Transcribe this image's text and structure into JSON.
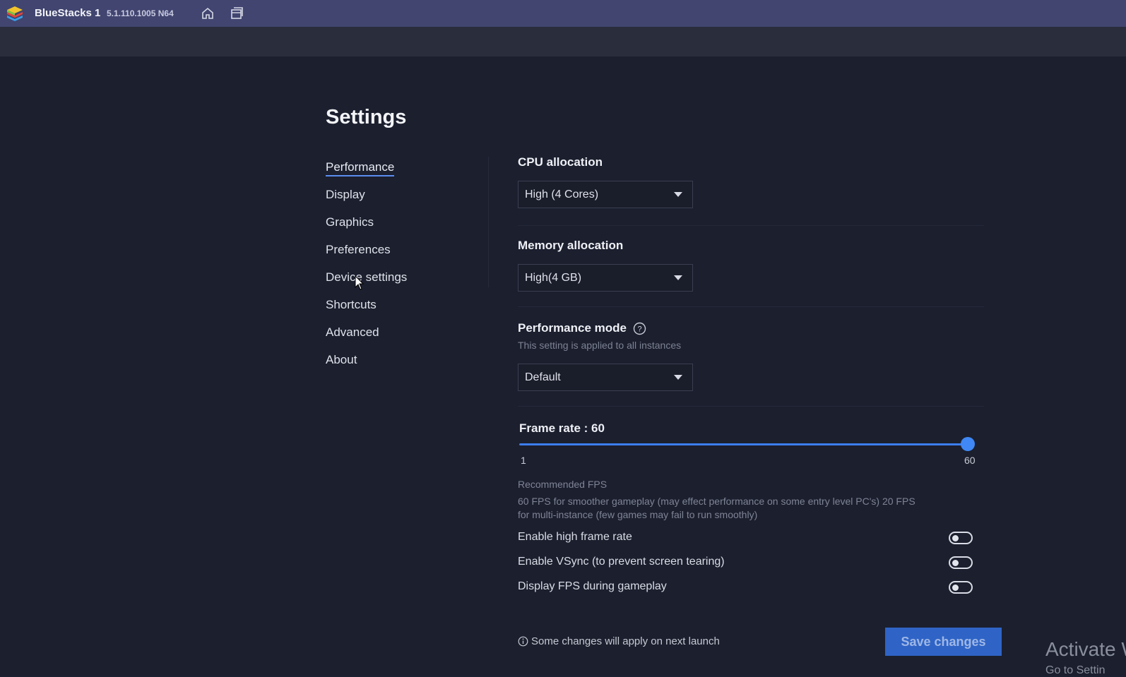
{
  "titlebar": {
    "app_name": "BlueStacks 1",
    "version": "5.1.110.1005 N64"
  },
  "settings": {
    "title": "Settings",
    "nav": [
      {
        "label": "Performance",
        "active": true
      },
      {
        "label": "Display"
      },
      {
        "label": "Graphics"
      },
      {
        "label": "Preferences"
      },
      {
        "label": "Device settings"
      },
      {
        "label": "Shortcuts"
      },
      {
        "label": "Advanced"
      },
      {
        "label": "About"
      }
    ]
  },
  "performance": {
    "cpu_label": "CPU allocation",
    "cpu_value": "High (4 Cores)",
    "memory_label": "Memory allocation",
    "memory_value": "High(4 GB)",
    "mode_label": "Performance mode",
    "mode_note": "This setting is applied to all instances",
    "mode_value": "Default",
    "frame_rate_label": "Frame rate : 60",
    "frame_rate": {
      "min": "1",
      "max": "60",
      "value": 60
    },
    "recommended_title": "Recommended FPS",
    "recommended_text_1": "60 FPS for smoother gameplay (may effect performance on some entry level PC's) 20 FPS",
    "recommended_text_2": "for multi-instance (few games may fail to run smoothly)",
    "toggles": [
      {
        "label": "Enable high frame rate",
        "on": false
      },
      {
        "label": "Enable VSync (to prevent screen tearing)",
        "on": false
      },
      {
        "label": "Display FPS during gameplay",
        "on": false
      }
    ],
    "note": "Some changes will apply on next launch",
    "save_label": "Save changes"
  },
  "watermark": {
    "line1": "Activate W",
    "line2": "Go to Settin"
  },
  "colors": {
    "titlebar": "#414570",
    "background": "#1b1f2e",
    "accent": "#3f88f5",
    "save_button": "#2f64c6"
  }
}
